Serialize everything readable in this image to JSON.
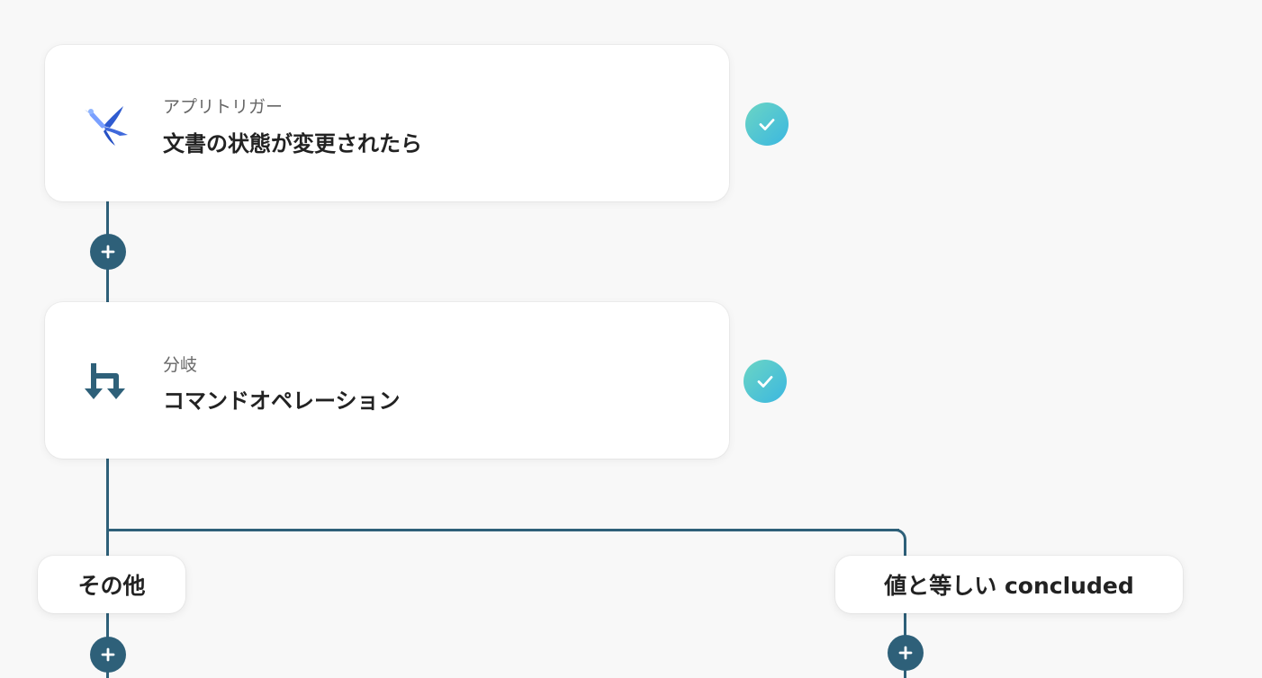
{
  "flow": {
    "steps": [
      {
        "subtitle": "アプリトリガー",
        "title": "文書の状態が変更されたら",
        "icon": "app-bird-icon",
        "status": "completed-check-icon"
      },
      {
        "subtitle": "分岐",
        "title": "コマンドオペレーション",
        "icon": "branch-icon",
        "status": "completed-check-icon"
      }
    ],
    "branches": [
      {
        "label": "その他"
      },
      {
        "label": "値と等しい concluded"
      }
    ],
    "add_icon": "plus-icon"
  },
  "colors": {
    "connector": "#2e6079",
    "check_gradient_start": "#6bd5c4",
    "check_gradient_end": "#3bb7e0",
    "background": "#f8f8f8"
  }
}
